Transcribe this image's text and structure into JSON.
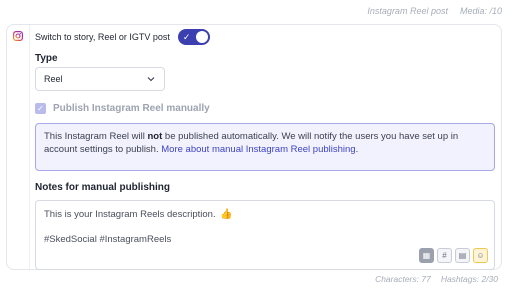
{
  "header": {
    "post_type": "Instagram Reel post",
    "media_count": "Media: /10"
  },
  "switch": {
    "label": "Switch to story, Reel or IGTV post",
    "on": true
  },
  "type_section": {
    "label": "Type",
    "selected": "Reel"
  },
  "manual_publish": {
    "label": "Publish Instagram Reel manually",
    "checked": true
  },
  "notice": {
    "text_before": "This Instagram Reel will ",
    "bold": "not",
    "text_after": " be published automatically. We will notify the users you have set up in account settings to publish. ",
    "link": "More about manual Instagram Reel publishing",
    "end": "."
  },
  "notes": {
    "label": "Notes for manual publishing",
    "line1": "This is your Instagram Reels description.",
    "line1_emoji": "👍",
    "line2": "#SkedSocial #InstagramReels"
  },
  "toolbar": {
    "media_icon": "image-library-icon",
    "hashtag_icon": "hashtag-icon",
    "caption_icon": "saved-caption-icon",
    "emoji_icon": "emoji-icon"
  },
  "footer": {
    "characters": "Characters: 77",
    "hashtags": "Hashtags: 2/30"
  },
  "colors": {
    "accent": "#3c3fb0",
    "link": "#3e43c2",
    "notice_bg": "#f2f2fe",
    "notice_border": "#a6a9e6"
  }
}
